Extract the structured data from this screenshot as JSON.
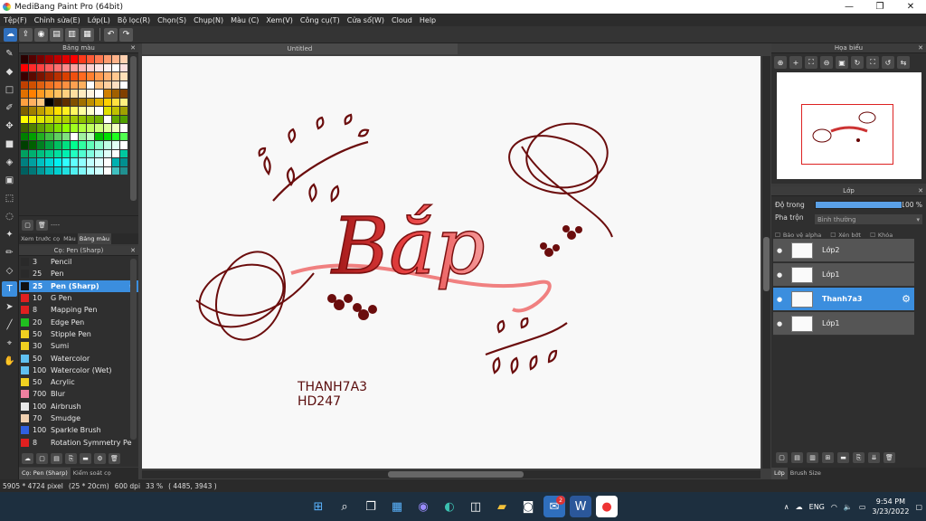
{
  "app": {
    "title": "MediBang Paint Pro (64bit)",
    "minimize": "—",
    "maximize": "❐",
    "close": "✕"
  },
  "menu": [
    "Tệp(F)",
    "Chỉnh sửa(E)",
    "Lớp(L)",
    "Bộ lọc(R)",
    "Chọn(S)",
    "Chụp(N)",
    "Màu (C)",
    "Xem(V)",
    "Công cụ(T)",
    "Cửa sổ(W)",
    "Cloud",
    "Help"
  ],
  "palette": {
    "title": "Bảng màu",
    "close": "✕",
    "footer_text": "----",
    "colors": [
      "#2a0000",
      "#550000",
      "#7a0000",
      "#a00000",
      "#c00000",
      "#e00000",
      "#ff0000",
      "#ff3a1a",
      "#ff5a36",
      "#ff7a52",
      "#ff9a6e",
      "#ffb38a",
      "#ffd0b0",
      "#ff0000",
      "#ff2a2a",
      "#ff4040",
      "#ff5a5a",
      "#ff7070",
      "#ff8a8a",
      "#ffa0a0",
      "#ffb8b8",
      "#ffd0d0",
      "#ffe4e4",
      "#fff0f0",
      "#ffffff",
      "#ffe0e0",
      "#3a0000",
      "#5a0a00",
      "#7a1400",
      "#9a2000",
      "#ba3000",
      "#da4000",
      "#f05010",
      "#ff6a20",
      "#ff8030",
      "#ff9a50",
      "#ffb070",
      "#ffc890",
      "#ffe0b8",
      "#c04000",
      "#d05000",
      "#e06010",
      "#f07020",
      "#ff8030",
      "#ff9040",
      "#ffa050",
      "#ffb060",
      "#ffffff",
      "#ffc080",
      "#ffd0a0",
      "#ffe0c0",
      "#ffffff",
      "#e07000",
      "#ff8000",
      "#ff9a20",
      "#ffb040",
      "#ffc060",
      "#ffd080",
      "#ffe0a0",
      "#ffecc0",
      "#fff4e0",
      "#ffffff",
      "#d08000",
      "#a06000",
      "#804000",
      "#ffa040",
      "#ffb060",
      "#ffc880",
      "#000000",
      "#402000",
      "#603000",
      "#805000",
      "#a07000",
      "#c09000",
      "#e0b000",
      "#ffd000",
      "#ffe040",
      "#fff080",
      "#806000",
      "#a08000",
      "#c0a000",
      "#e0c000",
      "#ffe000",
      "#fff020",
      "#fff860",
      "#ffffa0",
      "#ffffd0",
      "#ffffff",
      "#e0e000",
      "#c0c000",
      "#a0a000",
      "#ffff00",
      "#f0f000",
      "#e0e800",
      "#d0e000",
      "#c0d800",
      "#b0d000",
      "#a0c800",
      "#90c000",
      "#80b800",
      "#70b000",
      "#ffffff",
      "#60a800",
      "#50a000",
      "#406000",
      "#508000",
      "#60a000",
      "#70c000",
      "#80e000",
      "#90ff00",
      "#a0ff20",
      "#b0ff40",
      "#c0ff60",
      "#d0ff80",
      "#e0ffa0",
      "#f0ffc0",
      "#ffffff",
      "#008000",
      "#00a000",
      "#20b020",
      "#40c040",
      "#60d060",
      "#80e080",
      "#ffffff",
      "#a0f0a0",
      "#c0ffc0",
      "#00c000",
      "#00e000",
      "#20ff20",
      "#50ff50",
      "#004000",
      "#006000",
      "#008020",
      "#00a040",
      "#00c060",
      "#00e080",
      "#00ff90",
      "#30ffa0",
      "#60ffb8",
      "#90ffd0",
      "#c0ffe4",
      "#e0fff4",
      "#ffffff",
      "#00a060",
      "#00b070",
      "#00c080",
      "#00d090",
      "#00e0a0",
      "#00f0b0",
      "#20ffc0",
      "#50ffd0",
      "#80ffe0",
      "#b0fff0",
      "#e0fff8",
      "#ffffff",
      "#00c8a0",
      "#008080",
      "#00a0a0",
      "#00c0c0",
      "#00d8d8",
      "#00f0f0",
      "#30ffff",
      "#60ffff",
      "#90ffff",
      "#c0ffff",
      "#e0ffff",
      "#ffffff",
      "#00b0b0",
      "#009090",
      "#006060",
      "#007878",
      "#009898",
      "#00b8b8",
      "#00d0d0",
      "#20e0e0",
      "#50f0f0",
      "#80f8f8",
      "#b0ffff",
      "#d0ffff",
      "#ffffff",
      "#40c0c0",
      "#209090"
    ],
    "tabs": [
      "Xem trước cọ",
      "Màu",
      "Bảng màu"
    ]
  },
  "brush": {
    "title": "Cọ: Pen (Sharp)",
    "close": "✕",
    "items": [
      {
        "size": "3",
        "name": "Pencil",
        "color": "#2a2a2a"
      },
      {
        "size": "25",
        "name": "Pen",
        "color": "#2a2a2a"
      },
      {
        "size": "25",
        "name": "Pen (Sharp)",
        "color": "#111111",
        "selected": true
      },
      {
        "size": "10",
        "name": "G Pen",
        "color": "#e02020"
      },
      {
        "size": "8",
        "name": "Mapping Pen",
        "color": "#e02020"
      },
      {
        "size": "20",
        "name": "Edge Pen",
        "color": "#20c020"
      },
      {
        "size": "50",
        "name": "Stipple Pen",
        "color": "#f0d020"
      },
      {
        "size": "30",
        "name": "Sumi",
        "color": "#f0d020"
      },
      {
        "size": "50",
        "name": "Watercolor",
        "color": "#60c0f0"
      },
      {
        "size": "100",
        "name": "Watercolor (Wet)",
        "color": "#60c0f0"
      },
      {
        "size": "50",
        "name": "Acrylic",
        "color": "#f0d020"
      },
      {
        "size": "700",
        "name": "Blur",
        "color": "#f080a0"
      },
      {
        "size": "100",
        "name": "Airbrush",
        "color": "#e8e8e8"
      },
      {
        "size": "70",
        "name": "Smudge",
        "color": "#f0d0b0"
      },
      {
        "size": "100",
        "name": "Sparkle Brush",
        "color": "#3060e0"
      },
      {
        "size": "8",
        "name": "Rotation Symmetry Pe",
        "color": "#e02020"
      }
    ],
    "bottom_tabs": [
      "Cọ: Pen (Sharp)",
      "Kiểm soát cọ"
    ]
  },
  "canvas": {
    "doc_title": "Untitled",
    "artwork_text": "Bắp",
    "signature_line1": "THANH7A3",
    "signature_line2": "HD247"
  },
  "navigator": {
    "title": "Họa biểu",
    "close": "✕"
  },
  "layers": {
    "title": "Lớp",
    "close": "✕",
    "opacity_label": "Độ trong",
    "opacity_value": "100 %",
    "opacity": 1.0,
    "blend_label": "Pha trộn",
    "blend_value": "Bình thường",
    "protect_alpha": "Bảo vệ alpha",
    "clipping": "Xén bớt",
    "lock": "Khóa",
    "items": [
      {
        "name": "Lớp2",
        "selected": false
      },
      {
        "name": "Lớp1",
        "selected": false
      },
      {
        "name": "Thanh7a3",
        "selected": true
      },
      {
        "name": "Lớp1",
        "selected": false
      }
    ],
    "bottom_tabs": [
      "Lớp",
      "Brush Size"
    ]
  },
  "status": {
    "dimensions": "5905 * 4724 pixel",
    "size_cm": "(25 * 20cm)",
    "dpi": "600 dpi",
    "zoom": "33 %",
    "coords": "( 4485, 3943 )"
  },
  "taskbar": {
    "lang": "ENG",
    "time": "9:54 PM",
    "date": "3/23/2022",
    "badge_count": "2"
  }
}
